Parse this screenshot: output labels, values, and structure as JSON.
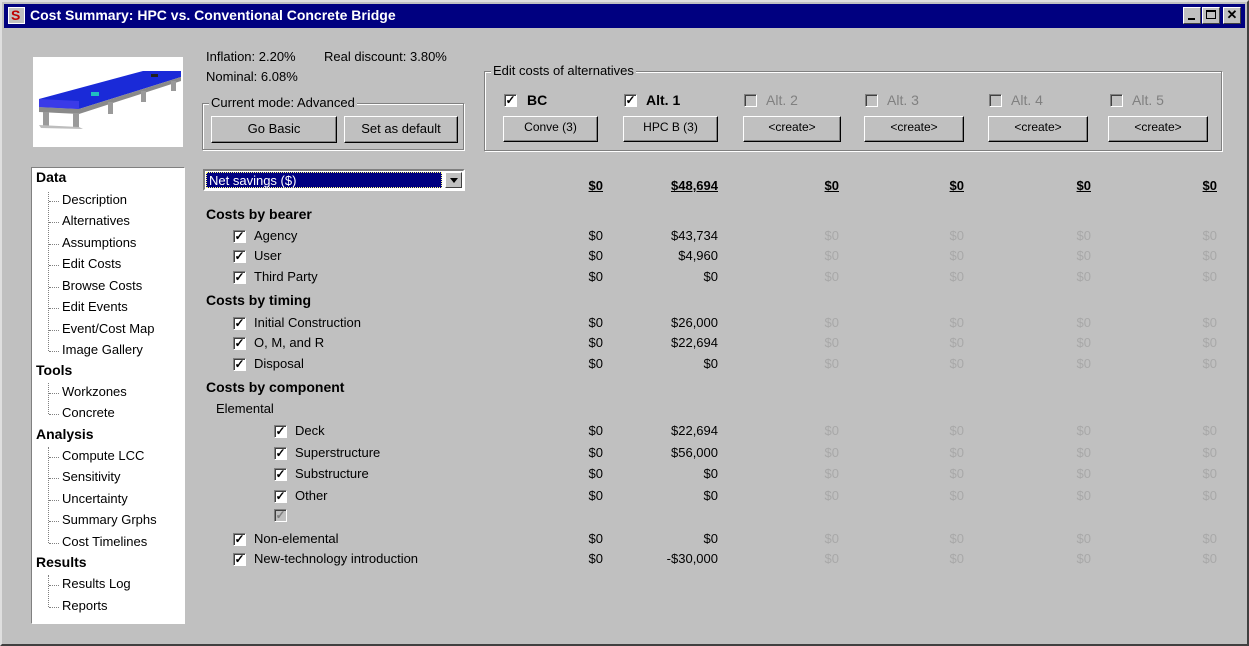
{
  "window": {
    "title": "Cost Summary: HPC vs. Conventional Concrete Bridge",
    "icon": "app-icon"
  },
  "rates": {
    "inflation": "Inflation: 2.20%",
    "real_discount": "Real discount: 3.80%",
    "nominal": "Nominal: 6.08%"
  },
  "mode": {
    "label": "Current mode: Advanced",
    "go_basic": "Go Basic",
    "set_default": "Set as default"
  },
  "alternatives": {
    "group_label": "Edit costs of alternatives",
    "items": [
      {
        "label": "BC",
        "button": "Conve (3)",
        "checked": true
      },
      {
        "label": "Alt. 1",
        "button": "HPC B (3)",
        "checked": true
      },
      {
        "label": "Alt. 2",
        "button": "<create>",
        "checked": false
      },
      {
        "label": "Alt. 3",
        "button": "<create>",
        "checked": false
      },
      {
        "label": "Alt. 4",
        "button": "<create>",
        "checked": false
      },
      {
        "label": "Alt. 5",
        "button": "<create>",
        "checked": false
      }
    ]
  },
  "tree": {
    "data": "Data",
    "data_items": [
      "Description",
      "Alternatives",
      "Assumptions",
      "Edit Costs",
      "Browse Costs",
      "Edit Events",
      "Event/Cost Map",
      "Image Gallery"
    ],
    "tools": "Tools",
    "tools_items": [
      "Workzones",
      "Concrete"
    ],
    "analysis": "Analysis",
    "analysis_items": [
      "Compute LCC",
      "Sensitivity",
      "Uncertainty",
      "Summary Grphs",
      "Cost Timelines"
    ],
    "results": "Results",
    "results_items": [
      "Results Log",
      "Reports"
    ]
  },
  "summary": {
    "selector": "Net savings ($)",
    "totals": [
      "$0",
      "$48,694",
      "$0",
      "$0",
      "$0",
      "$0"
    ],
    "bearer_title": "Costs by bearer",
    "bearer": [
      {
        "label": "Agency",
        "values": [
          "$0",
          "$43,734",
          "$0",
          "$0",
          "$0",
          "$0"
        ]
      },
      {
        "label": "User",
        "values": [
          "$0",
          "$4,960",
          "$0",
          "$0",
          "$0",
          "$0"
        ]
      },
      {
        "label": "Third Party",
        "values": [
          "$0",
          "$0",
          "$0",
          "$0",
          "$0",
          "$0"
        ]
      }
    ],
    "timing_title": "Costs by timing",
    "timing": [
      {
        "label": "Initial Construction",
        "values": [
          "$0",
          "$26,000",
          "$0",
          "$0",
          "$0",
          "$0"
        ]
      },
      {
        "label": "O, M, and R",
        "values": [
          "$0",
          "$22,694",
          "$0",
          "$0",
          "$0",
          "$0"
        ]
      },
      {
        "label": "Disposal",
        "values": [
          "$0",
          "$0",
          "$0",
          "$0",
          "$0",
          "$0"
        ]
      }
    ],
    "component_title": "Costs by component",
    "elemental_label": "Elemental",
    "elemental": [
      {
        "label": "Deck",
        "values": [
          "$0",
          "$22,694",
          "$0",
          "$0",
          "$0",
          "$0"
        ]
      },
      {
        "label": "Superstructure",
        "values": [
          "$0",
          "$56,000",
          "$0",
          "$0",
          "$0",
          "$0"
        ]
      },
      {
        "label": "Substructure",
        "values": [
          "$0",
          "$0",
          "$0",
          "$0",
          "$0",
          "$0"
        ]
      },
      {
        "label": "Other",
        "values": [
          "$0",
          "$0",
          "$0",
          "$0",
          "$0",
          "$0"
        ]
      }
    ],
    "other_rows": [
      {
        "label": "Non-elemental",
        "values": [
          "$0",
          "$0",
          "$0",
          "$0",
          "$0",
          "$0"
        ]
      },
      {
        "label": "New-technology introduction",
        "values": [
          "$0",
          "-$30,000",
          "$0",
          "$0",
          "$0",
          "$0"
        ]
      }
    ]
  },
  "colors": {
    "titlebar": "#000080",
    "face": "#c0c0c0",
    "dim_text": "#a8a8a8",
    "bridge_deck": "#1a2ad8"
  }
}
